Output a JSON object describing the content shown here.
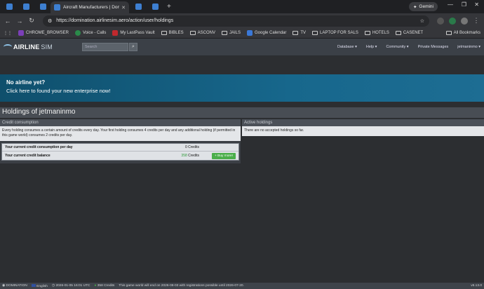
{
  "browser": {
    "active_tab_title": "Aircraft Manufacturers | Domin",
    "gemini_label": "Gemini",
    "url": "https://domination.airlinesim.aero/action/user/holdings",
    "bookmarks": [
      {
        "label": "CHROME_BROWSER",
        "icon": "purple-y-icon"
      },
      {
        "label": "Voice - Calls",
        "icon": "phone-icon"
      },
      {
        "label": "My LastPass Vault",
        "icon": "lastpass-icon"
      },
      {
        "label": "BIBLES",
        "icon": "folder-icon"
      },
      {
        "label": "ASCONV",
        "icon": "folder-icon"
      },
      {
        "label": "JAILS",
        "icon": "folder-icon"
      },
      {
        "label": "Google Calendar",
        "icon": "calendar-icon"
      },
      {
        "label": "TV",
        "icon": "folder-icon"
      },
      {
        "label": "LAPTOP FOR SALS",
        "icon": "folder-icon"
      },
      {
        "label": "HOTELS",
        "icon": "folder-icon"
      },
      {
        "label": "CASENET",
        "icon": "folder-icon"
      }
    ],
    "all_bookmarks_label": "All Bookmarks"
  },
  "site": {
    "logo_main": "AIRLINE",
    "logo_sub": "SIM",
    "search_placeholder": "Search",
    "nav": {
      "database": "Database ▾",
      "help": "Help ▾",
      "community": "Community ▾",
      "private_messages": "Private Messages",
      "user": "jetmaninmo ▾"
    }
  },
  "banner": {
    "title": "No airline yet?",
    "subtitle": "Click here to found your new enterprise now!"
  },
  "page": {
    "title": "Holdings of jetmaninmo",
    "credit_panel": {
      "header": "Credit consumption",
      "description": "Every holding consumes a certain amount of credits every day. Your first holding consumes 4 credits per day and any additional holding (if permitted in this game world) consumes 2 credits per day.",
      "row1_label": "Your current credit consumption per day",
      "row1_value": "0 Credits",
      "row2_label": "Your current credit balance",
      "row2_number": "358",
      "row2_unit": " Credits",
      "buy_button": "+ Buy more!"
    },
    "active_panel": {
      "header": "Active holdings",
      "text": "There are no accepted holdings so far."
    }
  },
  "statusbar": {
    "world": "DOMINATION",
    "language": "English",
    "datetime": "2026-01-05 16:01 UTC",
    "credits": "358 Credits",
    "notice": "This game world will end on 2026-08-03 with registrations possible until 2026-07-20.",
    "version": "v6.13.0"
  },
  "colors": {
    "accent_green": "#4aae4a",
    "banner_blue": "#17678c"
  }
}
